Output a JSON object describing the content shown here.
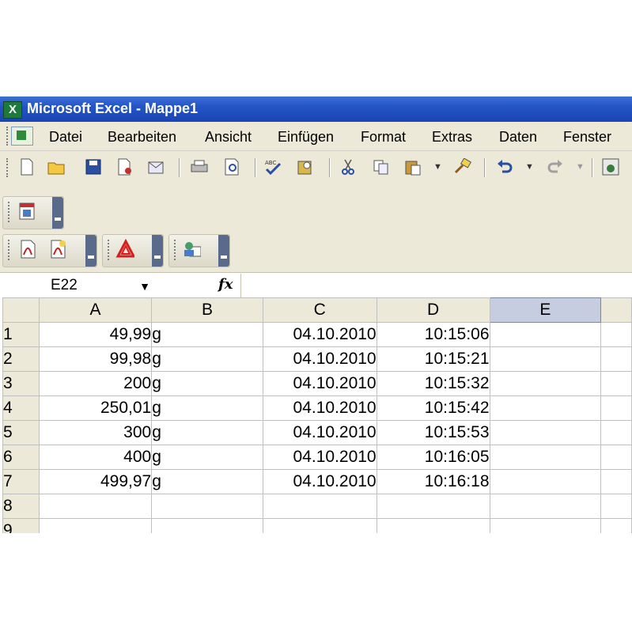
{
  "window": {
    "title": "Microsoft Excel - Mappe1",
    "app_icon": "excel-icon"
  },
  "menu": [
    "Datei",
    "Bearbeiten",
    "Ansicht",
    "Einfügen",
    "Format",
    "Extras",
    "Daten",
    "Fenster"
  ],
  "formula_bar": {
    "name_box": "E22",
    "fx_label": "fx",
    "formula": ""
  },
  "sheet": {
    "columns": [
      "A",
      "B",
      "C",
      "D",
      "E"
    ],
    "active_column": "E",
    "rows": [
      {
        "num": "1",
        "a": "49,99",
        "b": "g",
        "c": "04.10.2010",
        "d": "10:15:06",
        "e": ""
      },
      {
        "num": "2",
        "a": "99,98",
        "b": "g",
        "c": "04.10.2010",
        "d": "10:15:21",
        "e": ""
      },
      {
        "num": "3",
        "a": "200",
        "b": "g",
        "c": "04.10.2010",
        "d": "10:15:32",
        "e": ""
      },
      {
        "num": "4",
        "a": "250,01",
        "b": "g",
        "c": "04.10.2010",
        "d": "10:15:42",
        "e": ""
      },
      {
        "num": "5",
        "a": "300",
        "b": "g",
        "c": "04.10.2010",
        "d": "10:15:53",
        "e": ""
      },
      {
        "num": "6",
        "a": "400",
        "b": "g",
        "c": "04.10.2010",
        "d": "10:16:05",
        "e": ""
      },
      {
        "num": "7",
        "a": "499,97",
        "b": "g",
        "c": "04.10.2010",
        "d": "10:16:18",
        "e": ""
      },
      {
        "num": "8",
        "a": "",
        "b": "",
        "c": "",
        "d": "",
        "e": ""
      },
      {
        "num": "9",
        "a": "",
        "b": "",
        "c": "",
        "d": "",
        "e": ""
      }
    ]
  },
  "colors": {
    "titlebar": "#2454c6",
    "chrome": "#ece9d8",
    "active_header": "#c6cde0"
  }
}
